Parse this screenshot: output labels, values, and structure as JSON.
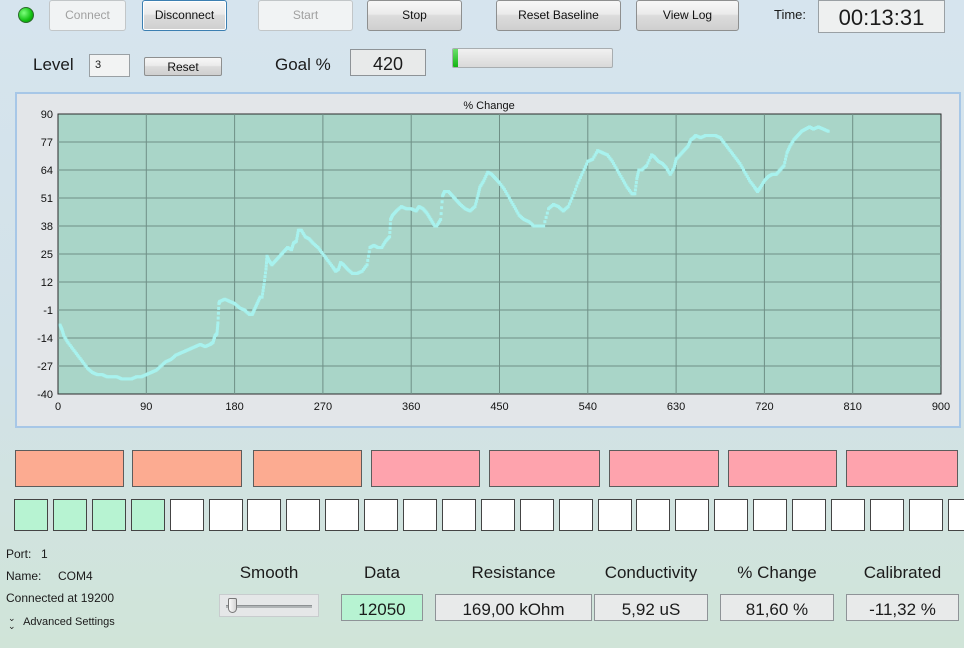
{
  "toolbar": {
    "connect_label": "Connect",
    "disconnect_label": "Disconnect",
    "start_label": "Start",
    "stop_label": "Stop",
    "reset_baseline_label": "Reset Baseline",
    "view_log_label": "View Log",
    "time_label": "Time:",
    "time_value": "00:13:31",
    "status_led_color": "#12c012"
  },
  "level": {
    "label": "Level",
    "value": "3",
    "reset_label": "Reset"
  },
  "goal": {
    "label": "Goal %",
    "value": "420",
    "progress_fraction": 0.03
  },
  "chart_data": {
    "type": "scatter",
    "title": "% Change",
    "xlabel": "",
    "ylabel": "",
    "xlim": [
      0,
      900
    ],
    "ylim": [
      -40,
      90
    ],
    "x_ticks": [
      0,
      90,
      180,
      270,
      360,
      450,
      540,
      630,
      720,
      810,
      900
    ],
    "y_ticks": [
      90,
      77,
      64,
      51,
      38,
      25,
      12,
      -1,
      -14,
      -27,
      -40
    ],
    "grid": true,
    "plot_background": "#a9d5c8",
    "point_color": "#a8f2ee",
    "points": [
      [
        2,
        -8
      ],
      [
        4,
        -10
      ],
      [
        6,
        -13
      ],
      [
        10,
        -16
      ],
      [
        15,
        -19
      ],
      [
        20,
        -22
      ],
      [
        25,
        -25
      ],
      [
        30,
        -28
      ],
      [
        35,
        -30
      ],
      [
        40,
        -31
      ],
      [
        45,
        -31
      ],
      [
        50,
        -32
      ],
      [
        55,
        -32
      ],
      [
        60,
        -32
      ],
      [
        65,
        -33
      ],
      [
        70,
        -33
      ],
      [
        75,
        -33
      ],
      [
        80,
        -32
      ],
      [
        85,
        -32
      ],
      [
        90,
        -31
      ],
      [
        95,
        -30
      ],
      [
        100,
        -29
      ],
      [
        105,
        -27
      ],
      [
        110,
        -25
      ],
      [
        115,
        -24
      ],
      [
        120,
        -22
      ],
      [
        125,
        -21
      ],
      [
        130,
        -20
      ],
      [
        135,
        -19
      ],
      [
        140,
        -18
      ],
      [
        145,
        -17
      ],
      [
        150,
        -18
      ],
      [
        155,
        -17
      ],
      [
        158,
        -16
      ],
      [
        160,
        -13
      ],
      [
        162,
        -12
      ],
      [
        163,
        -7
      ],
      [
        164,
        2
      ],
      [
        165,
        3
      ],
      [
        170,
        4
      ],
      [
        175,
        3
      ],
      [
        180,
        2
      ],
      [
        185,
        0
      ],
      [
        190,
        -1
      ],
      [
        195,
        -3
      ],
      [
        198,
        -3
      ],
      [
        200,
        -1
      ],
      [
        203,
        2
      ],
      [
        206,
        5
      ],
      [
        208,
        5
      ],
      [
        210,
        11
      ],
      [
        212,
        18
      ],
      [
        213,
        24
      ],
      [
        215,
        22
      ],
      [
        218,
        20
      ],
      [
        222,
        22
      ],
      [
        226,
        24
      ],
      [
        230,
        26
      ],
      [
        234,
        28
      ],
      [
        238,
        27
      ],
      [
        240,
        30
      ],
      [
        243,
        31
      ],
      [
        245,
        36
      ],
      [
        248,
        36
      ],
      [
        252,
        33
      ],
      [
        256,
        32
      ],
      [
        260,
        30
      ],
      [
        265,
        28
      ],
      [
        270,
        25
      ],
      [
        275,
        22
      ],
      [
        280,
        19
      ],
      [
        283,
        17
      ],
      [
        286,
        18
      ],
      [
        288,
        21
      ],
      [
        291,
        20
      ],
      [
        295,
        18
      ],
      [
        300,
        16
      ],
      [
        305,
        16
      ],
      [
        310,
        17
      ],
      [
        315,
        20
      ],
      [
        318,
        28
      ],
      [
        322,
        29
      ],
      [
        326,
        28
      ],
      [
        330,
        28
      ],
      [
        334,
        31
      ],
      [
        338,
        33
      ],
      [
        339,
        41
      ],
      [
        341,
        43
      ],
      [
        345,
        45
      ],
      [
        350,
        47
      ],
      [
        355,
        46
      ],
      [
        360,
        46
      ],
      [
        365,
        45
      ],
      [
        368,
        47
      ],
      [
        372,
        46
      ],
      [
        376,
        44
      ],
      [
        380,
        41
      ],
      [
        384,
        38
      ],
      [
        386,
        38
      ],
      [
        390,
        41
      ],
      [
        392,
        52
      ],
      [
        394,
        54
      ],
      [
        398,
        54
      ],
      [
        402,
        52
      ],
      [
        406,
        50
      ],
      [
        410,
        48
      ],
      [
        415,
        46
      ],
      [
        420,
        45
      ],
      [
        425,
        47
      ],
      [
        428,
        52
      ],
      [
        430,
        56
      ],
      [
        434,
        59
      ],
      [
        438,
        63
      ],
      [
        442,
        62
      ],
      [
        446,
        60
      ],
      [
        450,
        58
      ],
      [
        455,
        55
      ],
      [
        460,
        51
      ],
      [
        465,
        47
      ],
      [
        470,
        43
      ],
      [
        475,
        41
      ],
      [
        480,
        40
      ],
      [
        485,
        38
      ],
      [
        490,
        38
      ],
      [
        495,
        38
      ],
      [
        500,
        46
      ],
      [
        505,
        48
      ],
      [
        510,
        47
      ],
      [
        515,
        45
      ],
      [
        520,
        47
      ],
      [
        525,
        52
      ],
      [
        530,
        58
      ],
      [
        535,
        63
      ],
      [
        540,
        68
      ],
      [
        545,
        69
      ],
      [
        550,
        73
      ],
      [
        555,
        72
      ],
      [
        560,
        71
      ],
      [
        565,
        68
      ],
      [
        570,
        64
      ],
      [
        575,
        60
      ],
      [
        580,
        56
      ],
      [
        585,
        53
      ],
      [
        588,
        53
      ],
      [
        590,
        60
      ],
      [
        592,
        64
      ],
      [
        595,
        64
      ],
      [
        600,
        66
      ],
      [
        605,
        71
      ],
      [
        608,
        70
      ],
      [
        612,
        68
      ],
      [
        616,
        67
      ],
      [
        620,
        65
      ],
      [
        624,
        62
      ],
      [
        628,
        65
      ],
      [
        630,
        69
      ],
      [
        634,
        71
      ],
      [
        638,
        73
      ],
      [
        642,
        75
      ],
      [
        645,
        78
      ],
      [
        648,
        79
      ],
      [
        650,
        80
      ],
      [
        655,
        79
      ],
      [
        660,
        80
      ],
      [
        665,
        80
      ],
      [
        670,
        80
      ],
      [
        675,
        79
      ],
      [
        680,
        76
      ],
      [
        685,
        73
      ],
      [
        690,
        70
      ],
      [
        695,
        67
      ],
      [
        700,
        63
      ],
      [
        705,
        59
      ],
      [
        710,
        56
      ],
      [
        713,
        54
      ],
      [
        716,
        56
      ],
      [
        720,
        59
      ],
      [
        724,
        61
      ],
      [
        728,
        62
      ],
      [
        732,
        62
      ],
      [
        736,
        64
      ],
      [
        740,
        66
      ],
      [
        743,
        72
      ],
      [
        746,
        75
      ],
      [
        750,
        78
      ],
      [
        754,
        80
      ],
      [
        758,
        82
      ],
      [
        762,
        83
      ],
      [
        766,
        84
      ],
      [
        770,
        83
      ],
      [
        775,
        84
      ],
      [
        780,
        83
      ],
      [
        785,
        82
      ]
    ]
  },
  "pads_row": {
    "colors": [
      "#fcab91",
      "#fcab91",
      "#fcab91",
      "#fea3ad",
      "#fea3ad",
      "#fea3ad",
      "#fea3ad",
      "#fea3ad"
    ]
  },
  "level_squares": {
    "total": 25,
    "lit": 4,
    "lit_color": "#b7f3d2"
  },
  "port_info": {
    "port_label": "Port:",
    "port_value": "1",
    "name_label": "Name:",
    "name_value": "COM4",
    "connected_text": "Connected at 19200",
    "advanced_label": "Advanced Settings"
  },
  "readouts": {
    "smooth_label": "Smooth",
    "data_label": "Data",
    "data_value": "12050",
    "resistance_label": "Resistance",
    "resistance_value": "169,00 kOhm",
    "conductivity_label": "Conductivity",
    "conductivity_value": "5,92 uS",
    "pchange_label": "% Change",
    "pchange_value": "81,60 %",
    "calibrated_label": "Calibrated",
    "calibrated_value": "-11,32 %"
  }
}
